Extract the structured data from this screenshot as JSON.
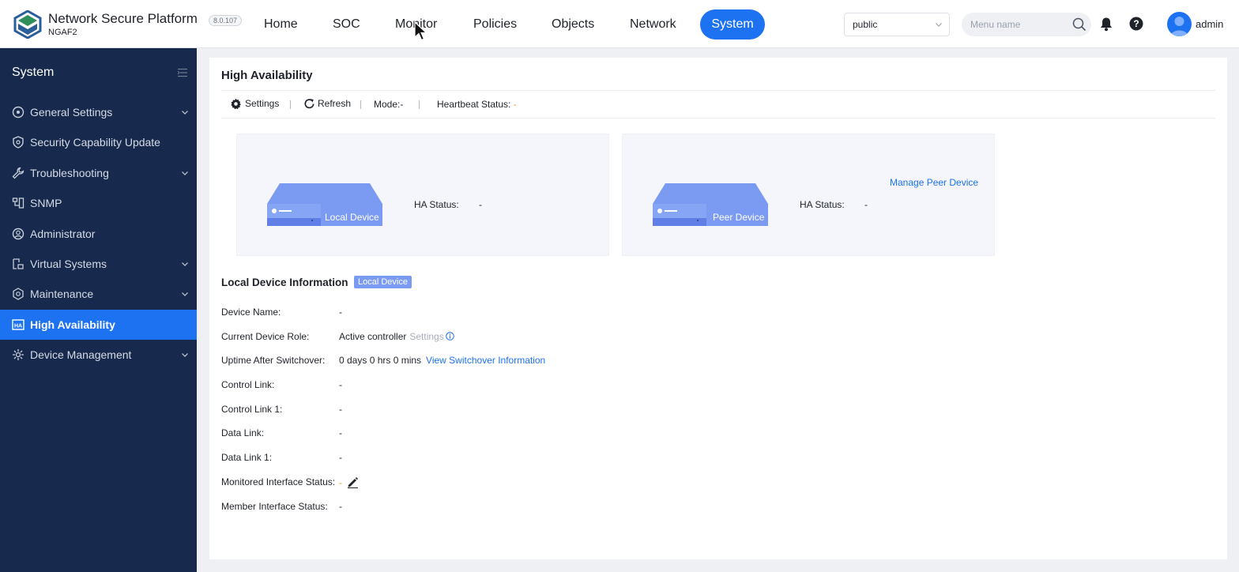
{
  "header": {
    "brand_title": "Network Secure Platform",
    "brand_sub": "NGAF2",
    "version": "8.0.107",
    "nav": [
      {
        "label": "Home",
        "active": false
      },
      {
        "label": "SOC",
        "active": false
      },
      {
        "label": "Monitor",
        "active": false
      },
      {
        "label": "Policies",
        "active": false
      },
      {
        "label": "Objects",
        "active": false
      },
      {
        "label": "Network",
        "active": false
      },
      {
        "label": "System",
        "active": true
      }
    ],
    "tenant": "public",
    "search_placeholder": "Menu name",
    "user": "admin",
    "icons": [
      "logo-icon",
      "chevron-down-icon",
      "search-icon",
      "bell-icon",
      "help-icon",
      "avatar"
    ]
  },
  "sidebar": {
    "title": "System",
    "items": [
      {
        "label": "General Settings",
        "icon": "gear-circle-icon",
        "expandable": true
      },
      {
        "label": "Security Capability Update",
        "icon": "shield-icon",
        "expandable": false
      },
      {
        "label": "Troubleshooting",
        "icon": "wrench-icon",
        "expandable": true
      },
      {
        "label": "SNMP",
        "icon": "network-icon",
        "expandable": false
      },
      {
        "label": "Administrator",
        "icon": "user-circle-icon",
        "expandable": false
      },
      {
        "label": "Virtual Systems",
        "icon": "virtual-system-icon",
        "expandable": true
      },
      {
        "label": "Maintenance",
        "icon": "maintenance-icon",
        "expandable": true
      },
      {
        "label": "High Availability",
        "icon": "ha-icon",
        "expandable": false,
        "active": true
      },
      {
        "label": "Device Management",
        "icon": "device-management-icon",
        "expandable": true
      }
    ]
  },
  "main": {
    "title": "High Availability",
    "toolbar": {
      "settings": "Settings",
      "refresh": "Refresh",
      "mode": "Mode:-",
      "heartbeat_label": "Heartbeat Status:",
      "heartbeat_value": "-"
    },
    "local_card": {
      "device_label": "Local Device",
      "ha_status_label": "HA Status:",
      "ha_status_value": "-"
    },
    "peer_card": {
      "device_label": "Peer Device",
      "ha_status_label": "HA Status:",
      "ha_status_value": "-",
      "manage_link": "Manage Peer Device"
    },
    "info": {
      "title": "Local Device Information",
      "tag": "Local Device",
      "rows": [
        {
          "key": "Device Name:",
          "value": "-"
        },
        {
          "key": "Current Device Role:",
          "value": "Active controller",
          "action": "Settings"
        },
        {
          "key": "Uptime After Switchover:",
          "value": "0 days 0 hrs 0 mins",
          "link": "View Switchover Information"
        },
        {
          "key": "Control Link:",
          "value": "-"
        },
        {
          "key": "Control Link 1:",
          "value": "-"
        },
        {
          "key": "Data Link:",
          "value": "-"
        },
        {
          "key": "Data Link 1:",
          "value": "-"
        },
        {
          "key": "Monitored Interface Status:",
          "value": "-"
        },
        {
          "key": "Member Interface Status:",
          "value": "-"
        }
      ]
    }
  },
  "colors": {
    "accent": "#1d72f2",
    "sidebar_bg": "#17294d",
    "status_dash": "#f59a23",
    "device_blue": "#7b9bf3"
  }
}
